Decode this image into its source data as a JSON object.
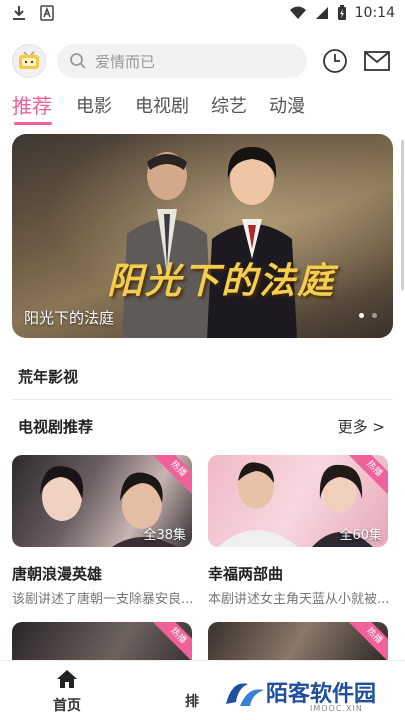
{
  "status_bar": {
    "time": "10:14",
    "icons": [
      "download-icon",
      "a-notification-icon",
      "wifi-icon",
      "signal-icon",
      "battery-icon"
    ]
  },
  "top_bar": {
    "search_placeholder": "爱情而已",
    "icons": [
      "bilibili-tv-icon",
      "search-icon",
      "history-clock-icon",
      "mail-icon"
    ]
  },
  "tabs": [
    {
      "label": "推荐",
      "active": true
    },
    {
      "label": "电影",
      "active": false
    },
    {
      "label": "电视剧",
      "active": false
    },
    {
      "label": "综艺",
      "active": false
    },
    {
      "label": "动漫",
      "active": false
    }
  ],
  "banner": {
    "title_art": "阳光下的法庭",
    "caption": "阳光下的法庭",
    "dots": 2,
    "active_dot": 1
  },
  "sections": {
    "brand": "荒年影视",
    "tv_recommend": "电视剧推荐",
    "more": "更多 >"
  },
  "cards": [
    {
      "badge": "热播",
      "episodes": "全38集",
      "title": "唐朝浪漫英雄",
      "desc": "该剧讲述了唐朝一支除暴安良..."
    },
    {
      "badge": "热播",
      "episodes": "全60集",
      "title": "幸福两部曲",
      "desc": "本剧讲述女主角天蓝从小就被..."
    },
    {
      "badge": "热播"
    },
    {
      "badge": "热播"
    }
  ],
  "bottom_nav": {
    "home": "首页",
    "rank": "排"
  },
  "watermark": {
    "text": "陌客软件园",
    "sub": "IMOOC.XIN"
  },
  "colors": {
    "accent": "#f0619a",
    "watermark_blue": "#1f4f9f"
  }
}
